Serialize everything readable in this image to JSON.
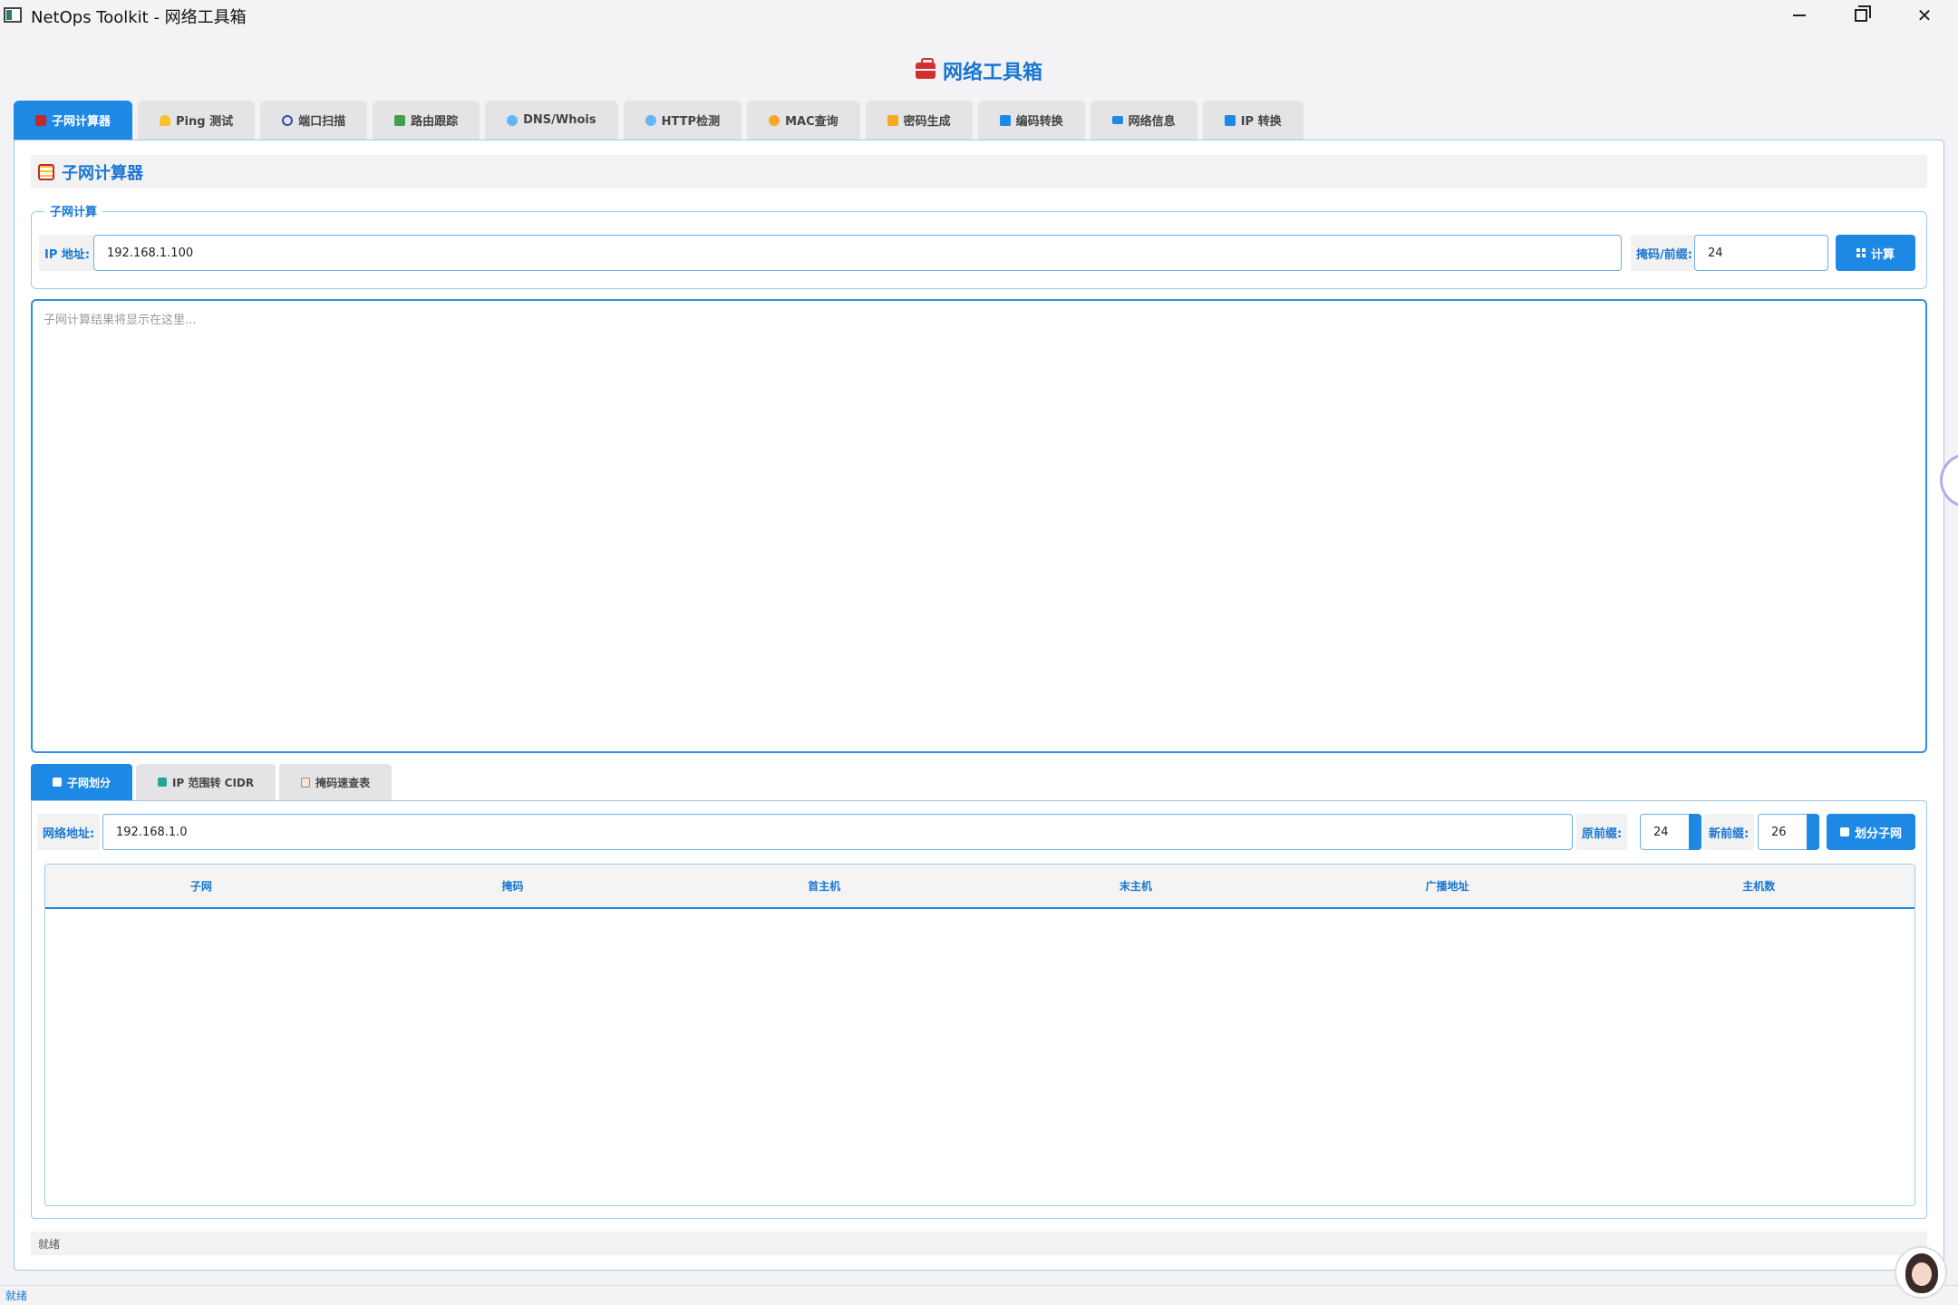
{
  "window": {
    "title": "NetOps Toolkit - 网络工具箱"
  },
  "header": {
    "title": "网络工具箱"
  },
  "main_tabs": [
    {
      "label": "子网计算器",
      "icon": "abacus-icon",
      "icon_color": "#c62828"
    },
    {
      "label": "Ping 测试",
      "icon": "bell-icon",
      "icon_color": "#fbc02d"
    },
    {
      "label": "端口扫描",
      "icon": "magnifier-icon",
      "icon_color": "#3949ab"
    },
    {
      "label": "路由跟踪",
      "icon": "map-icon",
      "icon_color": "#43a047"
    },
    {
      "label": "DNS/Whois",
      "icon": "globe-icon",
      "icon_color": "#64b5f6"
    },
    {
      "label": "HTTP检测",
      "icon": "globe-icon",
      "icon_color": "#64b5f6"
    },
    {
      "label": "MAC查询",
      "icon": "id-icon",
      "icon_color": "#f9a825"
    },
    {
      "label": "密码生成",
      "icon": "lock-icon",
      "icon_color": "#f9a825"
    },
    {
      "label": "编码转换",
      "icon": "swap-icon",
      "icon_color": "#1e88e5"
    },
    {
      "label": "网络信息",
      "icon": "monitor-icon",
      "icon_color": "#1e88e5"
    },
    {
      "label": "IP 转换",
      "icon": "swap-icon",
      "icon_color": "#1e88e5"
    }
  ],
  "active_main_tab": 0,
  "subnet_calc": {
    "section_title": "子网计算器",
    "group_title": "子网计算",
    "ip_label": "IP 地址:",
    "ip_value": "192.168.1.100",
    "mask_label": "掩码/前缀:",
    "mask_value": "24",
    "calc_button": "计算",
    "result_placeholder": "子网计算结果将显示在这里..."
  },
  "sub_tabs": [
    {
      "label": "子网划分",
      "icon": "ruler-icon"
    },
    {
      "label": "IP 范围转 CIDR",
      "icon": "swap-icon"
    },
    {
      "label": "掩码速查表",
      "icon": "clipboard-icon"
    }
  ],
  "active_sub_tab": 0,
  "subnet_divide": {
    "network_label": "网络地址:",
    "network_value": "192.168.1.0",
    "orig_prefix_label": "原前缀:",
    "orig_prefix_value": "24",
    "new_prefix_label": "新前缀:",
    "new_prefix_value": "26",
    "divide_button": "划分子网",
    "columns": [
      "子网",
      "掩码",
      "首主机",
      "末主机",
      "广播地址",
      "主机数"
    ],
    "rows": []
  },
  "inner_status": "就绪",
  "window_status": "就绪",
  "colors": {
    "accent": "#1e88e5",
    "accent_text": "#1976d2",
    "border": "#9cc9ee"
  }
}
